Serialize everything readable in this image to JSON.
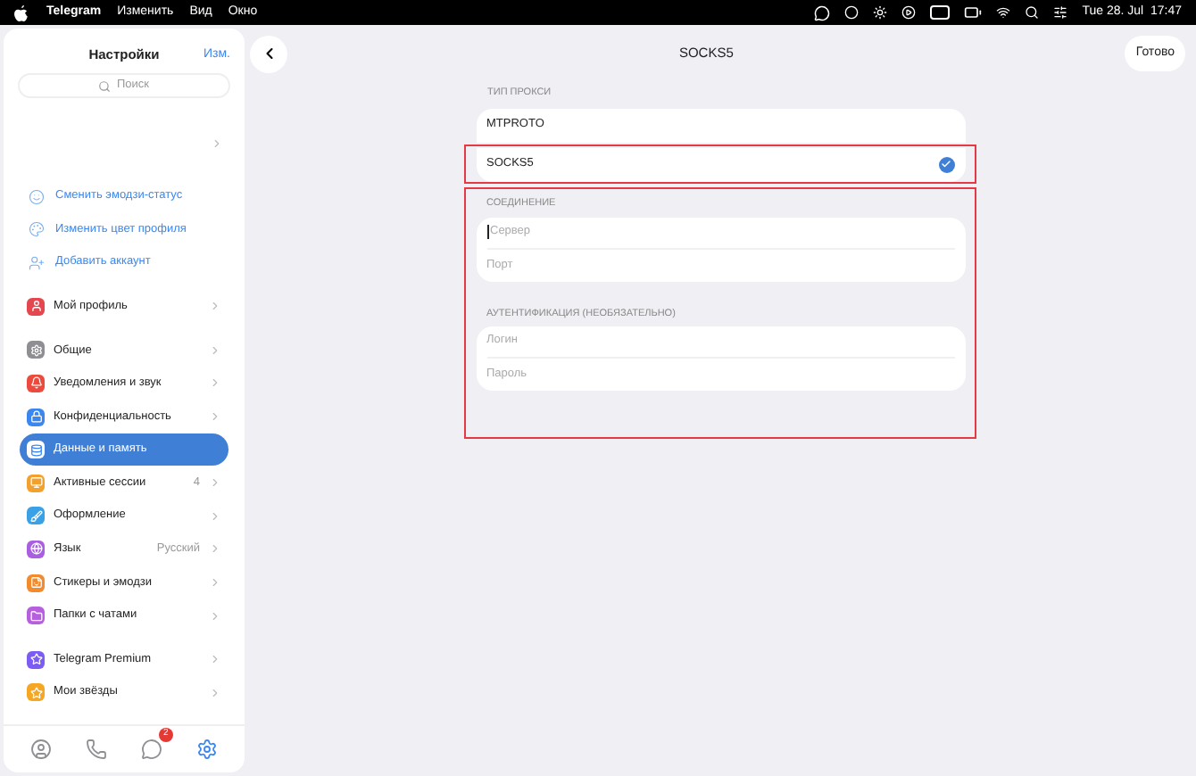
{
  "menu_bar": {
    "app": "Telegram",
    "menus": [
      "Изменить",
      "Вид",
      "Окно"
    ],
    "clock": "Tue 28. Jul  17:47"
  },
  "sidebar": {
    "title": "Настройки",
    "edit": "Изм.",
    "search": {
      "placeholder": "Поиск"
    },
    "links": [
      {
        "kind": "emoji",
        "label": "Сменить эмодзи-статус"
      },
      {
        "kind": "palette",
        "label": "Изменить цвет профиля"
      },
      {
        "kind": "add",
        "label": "Добавить аккаунт"
      }
    ],
    "groups": [
      [
        {
          "kind": "user",
          "label": "Мой профиль",
          "color": "#e5474f",
          "selected": false
        }
      ],
      [
        {
          "kind": "gear",
          "label": "Общие",
          "color": "#8e8e93",
          "selected": false
        },
        {
          "kind": "bell",
          "label": "Уведомления и звук",
          "color": "#ec4a3c",
          "selected": false
        },
        {
          "kind": "lock",
          "label": "Конфиденциальность",
          "color": "#3b87ef",
          "selected": false
        },
        {
          "kind": "data",
          "label": "Данные и память",
          "color": "#3b87ef",
          "selected": true
        },
        {
          "kind": "screen",
          "label": "Активные сессии",
          "color": "#f2a12e",
          "selected": false,
          "value": "4"
        },
        {
          "kind": "brush",
          "label": "Оформление",
          "color": "#3aa1e6",
          "selected": false
        },
        {
          "kind": "globe",
          "label": "Язык",
          "color": "#a95fdf",
          "selected": false,
          "value": "Русский"
        },
        {
          "kind": "sticker",
          "label": "Стикеры и эмодзи",
          "color": "#f28a2e",
          "selected": false
        },
        {
          "kind": "folder",
          "label": "Папки с чатами",
          "color": "#b660dd",
          "selected": false
        }
      ],
      [
        {
          "kind": "star",
          "label": "Telegram Premium",
          "color": "#7c5cf2",
          "selected": false
        },
        {
          "kind": "star",
          "label": "Мои звёзды",
          "color": "#f5a623",
          "selected": false
        }
      ]
    ],
    "tabs": [
      {
        "kind": "profile",
        "selected": false
      },
      {
        "kind": "calls",
        "selected": false
      },
      {
        "kind": "chats",
        "selected": false,
        "badge": "2"
      },
      {
        "kind": "settings",
        "selected": true
      }
    ]
  },
  "proxy": {
    "title": "SOCKS5",
    "done": "Готово",
    "type_label": "ТИП ПРОКСИ",
    "types": [
      {
        "label": "MTPROTO",
        "selected": false,
        "highlighted": false
      },
      {
        "label": "SOCKS5",
        "selected": true,
        "highlighted": true
      }
    ],
    "sections_highlighted": true,
    "sections": [
      {
        "label": "СОЕДИНЕНИЕ",
        "fields": [
          {
            "placeholder": "Сервер",
            "focused": true
          },
          {
            "placeholder": "Порт",
            "focused": false
          }
        ]
      },
      {
        "label": "АУТЕНТИФИКАЦИЯ (НЕОБЯЗАТЕЛЬНО)",
        "fields": [
          {
            "placeholder": "Логин",
            "focused": false
          },
          {
            "placeholder": "Пароль",
            "focused": false
          }
        ]
      }
    ]
  }
}
